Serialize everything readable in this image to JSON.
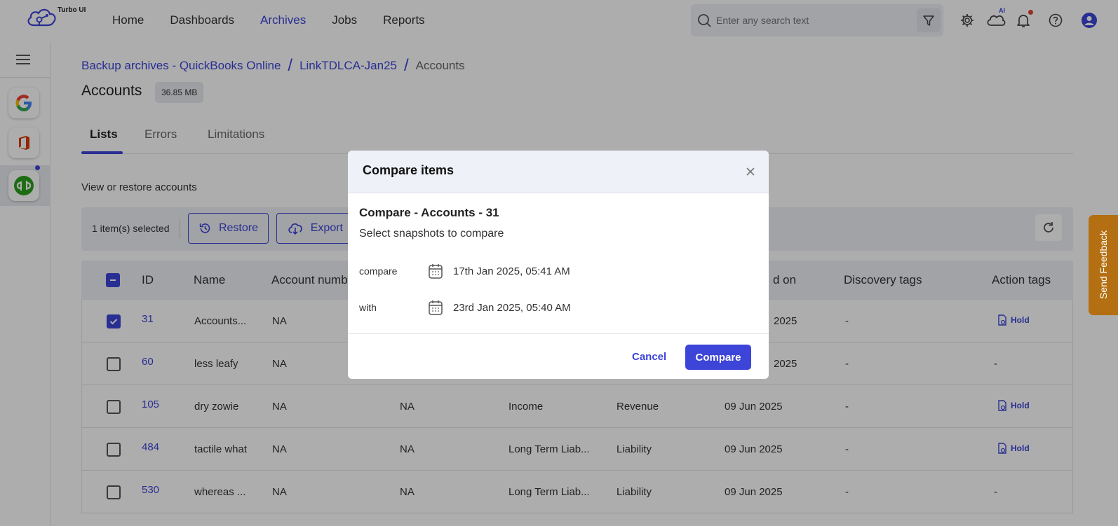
{
  "app": {
    "brand": "Turbo UI",
    "accent": "#3d44d8"
  },
  "nav": {
    "items": [
      "Home",
      "Dashboards",
      "Archives",
      "Jobs",
      "Reports"
    ],
    "active": "Archives"
  },
  "search": {
    "placeholder": "Enter any search text"
  },
  "topbar": {
    "ai_label": "AI"
  },
  "breadcrumb": [
    "Backup archives - QuickBooks Online",
    "LinkTDLCA-Jan25",
    "Accounts"
  ],
  "page": {
    "title": "Accounts",
    "size": "36.85 MB"
  },
  "tabs": [
    "Lists",
    "Errors",
    "Limitations"
  ],
  "section_label": "View or restore accounts",
  "toolbar": {
    "selected": "1 item(s) selected",
    "restore": "Restore",
    "export": "Export"
  },
  "table": {
    "headers": [
      "ID",
      "Name",
      "Account numb",
      "",
      "",
      "",
      "d on",
      "Discovery tags",
      "Action tags"
    ],
    "rows": [
      {
        "id": "31",
        "name": "Accounts...",
        "acct": "NA",
        "c4": "",
        "c5": "",
        "c6": "",
        "date": "2025",
        "disc": "-",
        "action": "Hold",
        "checked": true
      },
      {
        "id": "60",
        "name": "less leafy",
        "acct": "NA",
        "c4": "",
        "c5": "",
        "c6": "",
        "date": "2025",
        "disc": "-",
        "action": "-",
        "checked": false
      },
      {
        "id": "105",
        "name": "dry zowie",
        "acct": "NA",
        "c4": "NA",
        "c5": "Income",
        "c6": "Revenue",
        "date": "09 Jun 2025",
        "disc": "-",
        "action": "Hold",
        "checked": false
      },
      {
        "id": "484",
        "name": "tactile what",
        "acct": "NA",
        "c4": "NA",
        "c5": "Long Term Liab...",
        "c6": "Liability",
        "date": "09 Jun 2025",
        "disc": "-",
        "action": "Hold",
        "checked": false
      },
      {
        "id": "530",
        "name": "whereas ...",
        "acct": "NA",
        "c4": "NA",
        "c5": "Long Term Liab...",
        "c6": "Liability",
        "date": "09 Jun 2025",
        "disc": "-",
        "action": "-",
        "checked": false
      }
    ]
  },
  "modal": {
    "title": "Compare items",
    "subtitle": "Compare - Accounts - 31",
    "description": "Select snapshots to compare",
    "compare_label": "compare",
    "compare_value": "17th Jan 2025, 05:41 AM",
    "with_label": "with",
    "with_value": "23rd Jan 2025, 05:40 AM",
    "cancel": "Cancel",
    "confirm": "Compare"
  },
  "feedback": "Send Feedback"
}
